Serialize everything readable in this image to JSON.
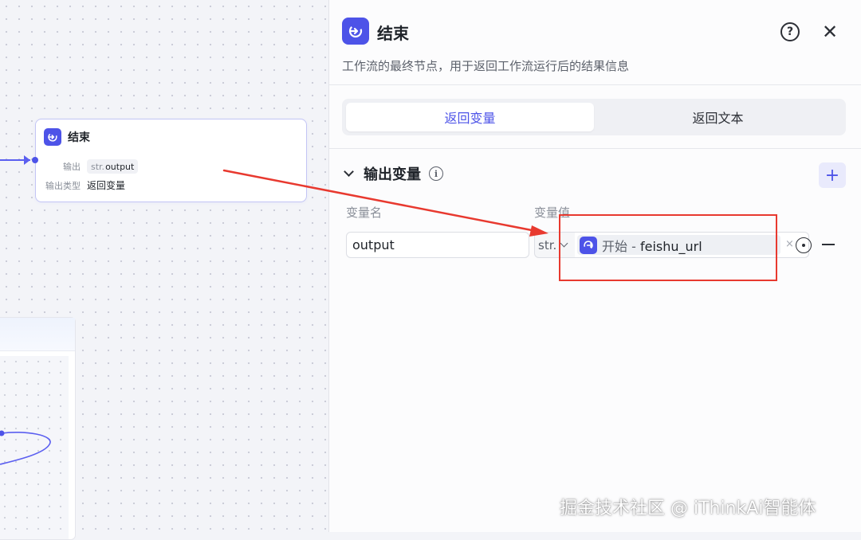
{
  "canvas": {
    "node": {
      "title": "结束",
      "rows": [
        {
          "label": "输出",
          "tag_prefix": "str.",
          "tag_value": "output"
        },
        {
          "label": "输出类型",
          "value": "返回变量"
        }
      ]
    }
  },
  "panel": {
    "title": "结束",
    "description": "工作流的最终节点，用于返回工作流运行后的结果信息",
    "help_label": "?",
    "close_label": "✕",
    "tabs": [
      {
        "label": "返回变量",
        "active": true
      },
      {
        "label": "返回文本",
        "active": false
      }
    ],
    "section": {
      "title": "输出变量",
      "info_label": "i",
      "add_label": "+",
      "columns": {
        "name": "变量名",
        "value": "变量值"
      },
      "rows": [
        {
          "name": "output",
          "type": "str.",
          "ref_node": "开始",
          "ref_separator": " - ",
          "ref_var": "feishu_url",
          "clear_label": "×"
        }
      ]
    }
  },
  "watermark": "掘金技术社区 @ iThinkAi智能体",
  "colors": {
    "accent": "#4d53e8",
    "annotation_red": "#e8392f"
  },
  "icons": {
    "end_node": "end-node-icon",
    "start_node": "start-node-icon",
    "help": "question-circle-icon",
    "close": "close-icon",
    "collapse": "chevron-down-icon",
    "info": "info-icon",
    "add": "plus-icon",
    "type_dropdown": "chevron-down-icon",
    "picker": "variable-picker-icon",
    "remove": "minus-icon"
  }
}
